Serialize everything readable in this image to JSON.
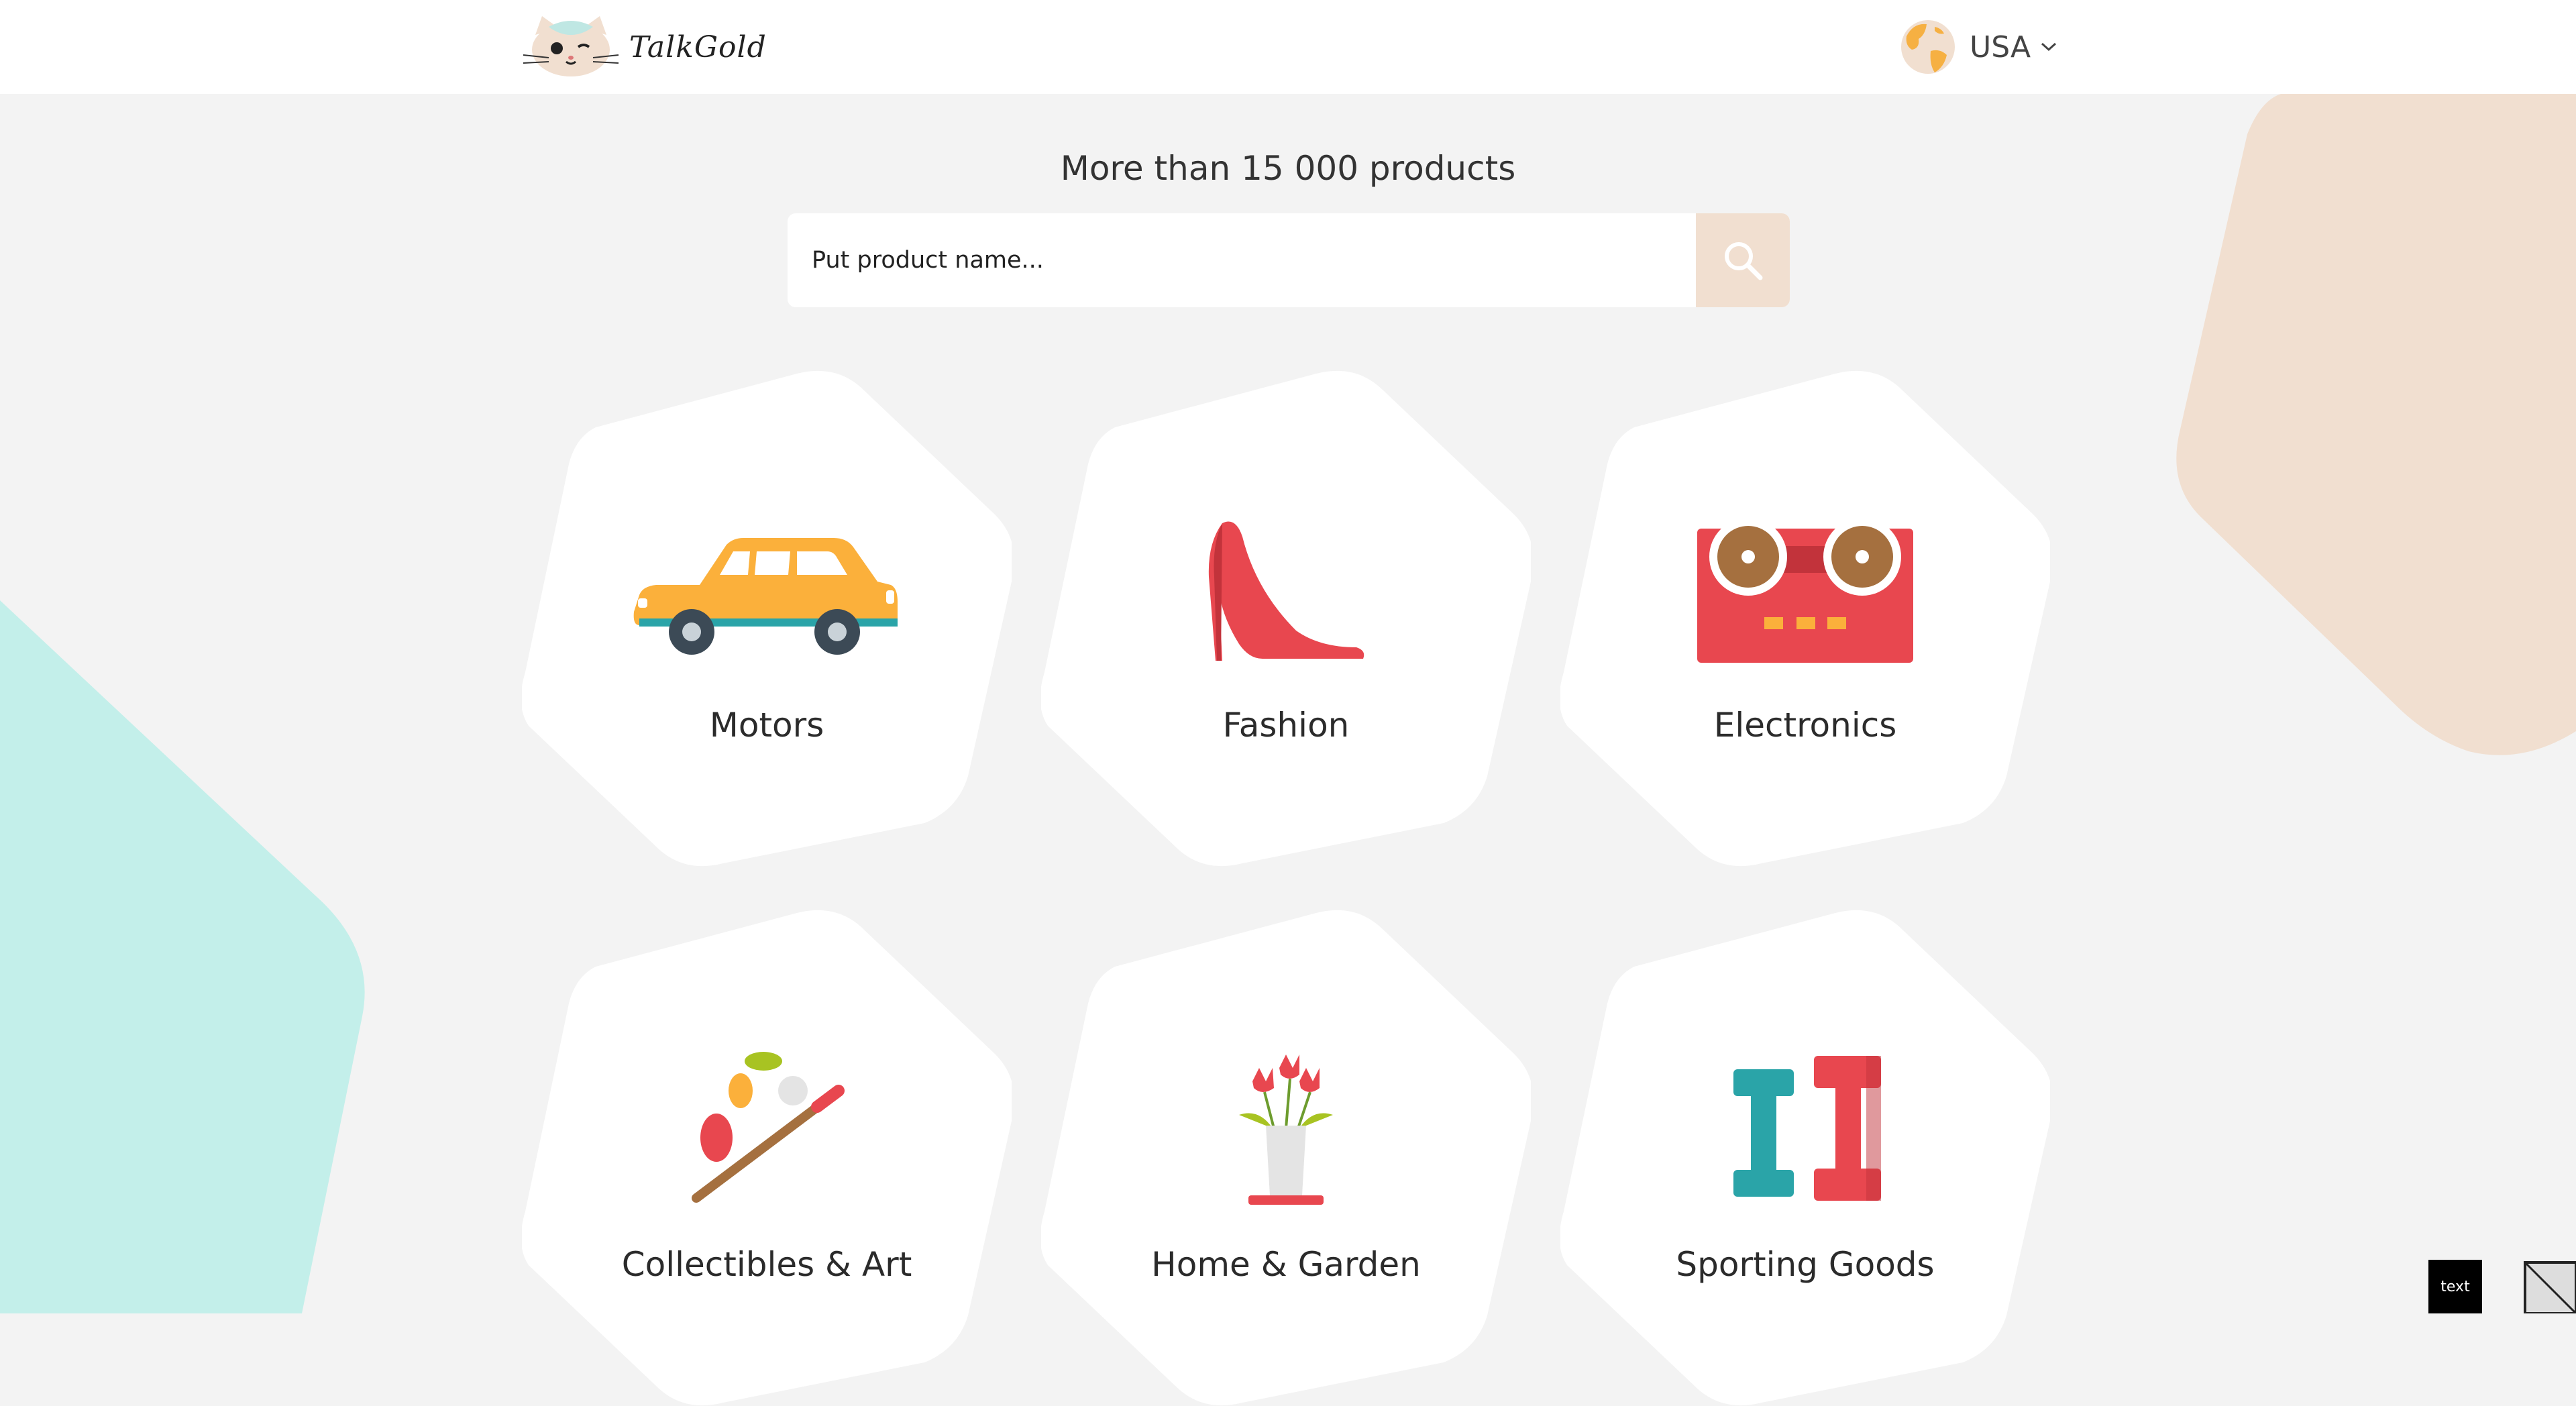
{
  "brand": {
    "name": "TalkGold"
  },
  "locale": {
    "country": "USA"
  },
  "hero": {
    "headline": "More than 15 000 products"
  },
  "search": {
    "placeholder": "Put product name..."
  },
  "categories": [
    {
      "label": "Motors",
      "icon": "car-icon"
    },
    {
      "label": "Fashion",
      "icon": "high-heel-shoe-icon"
    },
    {
      "label": "Electronics",
      "icon": "tape-recorder-icon"
    },
    {
      "label": "Collectibles & Art",
      "icon": "paint-palette-icon"
    },
    {
      "label": "Home & Garden",
      "icon": "flower-vase-icon"
    },
    {
      "label": "Sporting Goods",
      "icon": "dumbbell-icon"
    }
  ],
  "floating": {
    "text_button": "text"
  },
  "colors": {
    "background": "#f3f3f3",
    "teal_shape": "#c3efea",
    "peach_shape": "#f1dfd0",
    "search_button": "#f1dfd0"
  }
}
